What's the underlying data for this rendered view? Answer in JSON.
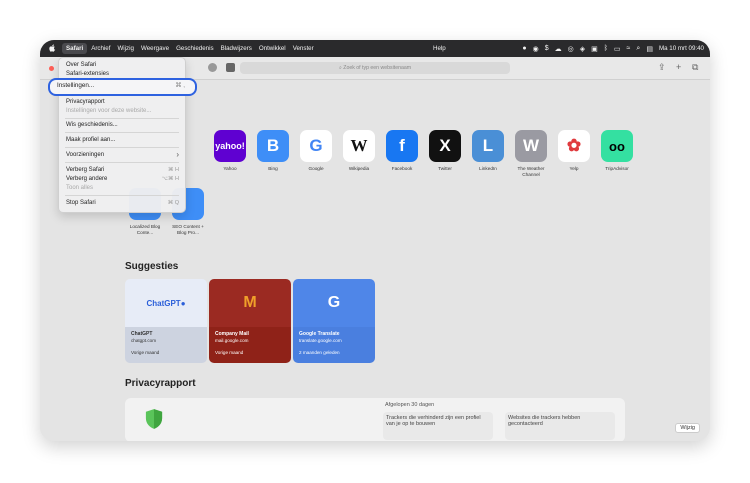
{
  "menubar": {
    "items": [
      "Safari",
      "Archief",
      "Wijzig",
      "Weergave",
      "Geschiedenis",
      "Bladwijzers",
      "Ontwikkel",
      "Venster",
      "Help"
    ],
    "clock": "Ma 10 mrt 09:40"
  },
  "toolbar": {
    "address_placeholder": "Zoek of typ een websitenaam"
  },
  "safari_menu": {
    "items": [
      {
        "label": "Over Safari",
        "shortcut": "",
        "disabled": false
      },
      {
        "label": "Safari-extensies",
        "shortcut": "",
        "disabled": false
      },
      {
        "label": "Instellingen...",
        "shortcut": "⌘ ,",
        "disabled": false
      },
      {
        "label": "Privacyrapport",
        "shortcut": "",
        "disabled": false
      },
      {
        "label": "Instellingen voor deze website...",
        "shortcut": "",
        "disabled": true
      },
      {
        "label": "Wis geschiedenis...",
        "shortcut": "",
        "disabled": false
      },
      {
        "label": "Maak profiel aan...",
        "shortcut": "",
        "disabled": false
      },
      {
        "label": "Voorzieningen",
        "shortcut": "›",
        "disabled": false
      },
      {
        "label": "Verberg Safari",
        "shortcut": "⌘ H",
        "disabled": false
      },
      {
        "label": "Verberg andere",
        "shortcut": "⌥⌘ H",
        "disabled": false
      },
      {
        "label": "Toon alles",
        "shortcut": "",
        "disabled": true
      },
      {
        "label": "Stop Safari",
        "shortcut": "⌘ Q",
        "disabled": false
      }
    ]
  },
  "favorites": [
    {
      "label": "Yahoo",
      "glyph": "yahoo!",
      "color": "#5f01d1"
    },
    {
      "label": "Bing",
      "glyph": "B",
      "color": "#3e8ef7"
    },
    {
      "label": "Google",
      "glyph": "G",
      "color": "#ffffff"
    },
    {
      "label": "Wikipedia",
      "glyph": "W",
      "color": "#ffffff"
    },
    {
      "label": "Facebook",
      "glyph": "f",
      "color": "#1877f2"
    },
    {
      "label": "Twitter",
      "glyph": "X",
      "color": "#111111"
    },
    {
      "label": "LinkedIn",
      "glyph": "L",
      "color": "#4a8fd6"
    },
    {
      "label": "The Weather Channel",
      "glyph": "W",
      "color": "#9a9aa2"
    },
    {
      "label": "Yelp",
      "glyph": "✿",
      "color": "#ffffff"
    },
    {
      "label": "TripAdvisor",
      "glyph": "oo",
      "color": "#34e0a1"
    }
  ],
  "favorites_row2": [
    {
      "label": "Localized Blog Conte...",
      "color": "#3e8ef7"
    },
    {
      "label": "SEO Content + Blog Pro...",
      "color": "#3e8ef7"
    }
  ],
  "suggestions": {
    "title": "Suggesties",
    "cards": [
      {
        "name": "ChatGPT",
        "url": "chatgpt.com",
        "when": "Vorige maand",
        "logo": "ChatGPT●",
        "top_color": "#e7ecf7",
        "bot_color": "#cdd3e0",
        "text_color": "#333333"
      },
      {
        "name": "Company Mail",
        "url": "mail.google.com",
        "when": "Vorige maand",
        "logo": "M",
        "top_color": "#9b2a22",
        "bot_color": "#8f2218",
        "text_color": "#ffffff"
      },
      {
        "name": "Google Translate",
        "url": "translate.google.com",
        "when": "2 maanden geleden",
        "logo": "G",
        "top_color": "#4f86e8",
        "bot_color": "#4a7fdf",
        "text_color": "#ffffff"
      }
    ]
  },
  "privacy": {
    "title": "Privacyrapport",
    "period": "Afgelopen 30 dagen",
    "trackers_prevented": "Trackers die verhinderd zijn een profiel van je op te bouwen",
    "websites_contacted": "Websites die trackers hebben gecontacteerd"
  },
  "edit_button": "Wijzig"
}
